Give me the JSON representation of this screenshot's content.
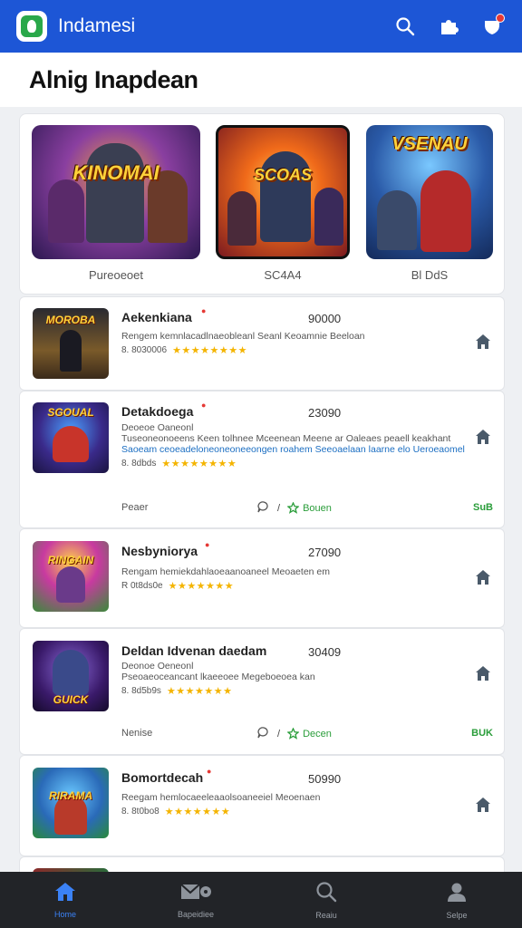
{
  "app": {
    "title": "Indamesi"
  },
  "page": {
    "title": "Alnig Inapdean"
  },
  "featured": [
    {
      "art_text": "KINOMAI",
      "caption": "Pureoeoet"
    },
    {
      "art_text": "SCOAS",
      "caption": "SC4A4"
    },
    {
      "art_text": "VSENAU",
      "caption": "Bl DdS"
    }
  ],
  "games": [
    {
      "thumb_text": "MOROBA",
      "name": "Aekenkiana",
      "count": "90000",
      "desc": [
        "Rengem kemnlacadlnaeobleanl Seanl Keoamnie Beeloan"
      ],
      "meta": "8. 8030006",
      "stars": "★★★★★★★★",
      "footer": null
    },
    {
      "thumb_text": "SGOUAL",
      "name": "Detakdoega",
      "count": "23090",
      "desc": [
        "Deoeoe Oaneonl",
        "Tuseoneonoeens Keen tolhnee Mceenean Meene ar Oaleaes peaell keakhant",
        "Saoeam ceoeadeloneoneoneeongen roahem Seeoaelaan laarne elo Ueroeaomel"
      ],
      "meta": "8. 8dbds",
      "stars": "★★★★★★★★",
      "footer": {
        "left": "Peaer",
        "mid": "Bouen",
        "right": "SuB"
      }
    },
    {
      "thumb_text": "RINGAIN",
      "name": "Nesbyniorya",
      "count": "27090",
      "desc": [
        "Rengam hemiekdahlaoeaanoaneel Meoaeten em"
      ],
      "meta": "R 0t8ds0e",
      "stars": "★★★★★★★",
      "footer": null
    },
    {
      "thumb_text": "GUICK",
      "name": "Deldan Idvenan daedam",
      "count": "30409",
      "desc": [
        "Deonoe Oeneonl",
        "Pseoaeoceancant lkaeeoee Megeboeoea kan"
      ],
      "meta": "8. 8d5b9s",
      "stars": "★★★★★★★",
      "footer": {
        "left": "Nenise",
        "mid": "Decen",
        "right": "BUK"
      }
    },
    {
      "thumb_text": "RIRAMA",
      "name": "Bomortdecah",
      "count": "50990",
      "desc": [
        "Reegam hemlocaeeleaaolsoaneeiel Meoenaen"
      ],
      "meta": "8. 8t0bo8",
      "stars": "★★★★★★★",
      "footer": null
    }
  ],
  "nav": [
    {
      "label": "Home",
      "icon": "home-icon"
    },
    {
      "label": "Bapeidiee",
      "icon": "mail-icon"
    },
    {
      "label": "Reaiu",
      "icon": "search-icon"
    },
    {
      "label": "Selpe",
      "icon": "profile-icon"
    }
  ]
}
